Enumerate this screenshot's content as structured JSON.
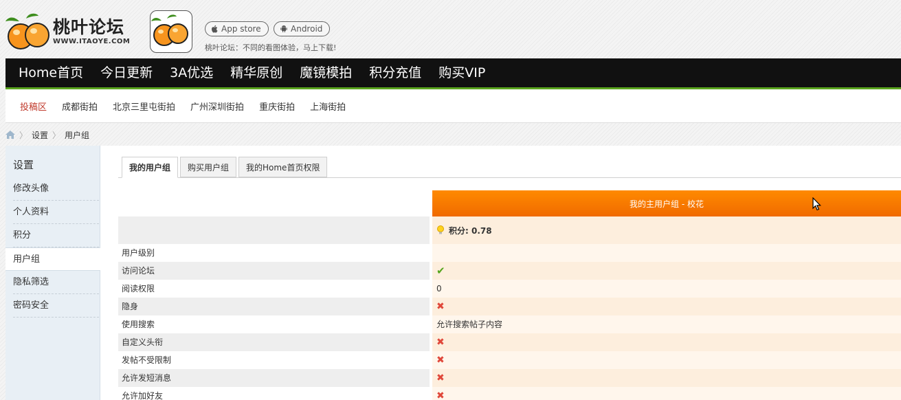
{
  "header": {
    "logo_text": "桃叶论坛",
    "logo_sub": "WWW.ITAOYE.COM",
    "appstore_label": "App store",
    "android_label": "Android",
    "app_tagline": "桃叶论坛：不同的看图体验，马上下载!"
  },
  "main_nav": [
    "Home首页",
    "今日更新",
    "3A优选",
    "精华原创",
    "魔镜模拍",
    "积分充值",
    "购买VIP"
  ],
  "sub_nav": [
    "投稿区",
    "成都街拍",
    "北京三里屯街拍",
    "广州深圳街拍",
    "重庆街拍",
    "上海街拍"
  ],
  "breadcrumb": [
    "设置",
    "用户组"
  ],
  "sidebar": {
    "title": "设置",
    "items": [
      "修改头像",
      "个人资料",
      "积分",
      "用户组",
      "隐私筛选",
      "密码安全"
    ]
  },
  "tabs": [
    "我的用户组",
    "购买用户组",
    "我的Home首页权限"
  ],
  "group": {
    "header": "我的主用户组 - 校花",
    "points": "积分: 0.78"
  },
  "rows": [
    {
      "label": "用户级别",
      "value": ""
    },
    {
      "label": "访问论坛",
      "value": "check"
    },
    {
      "label": "阅读权限",
      "value": "0"
    },
    {
      "label": "隐身",
      "value": "x"
    },
    {
      "label": "使用搜索",
      "value": "允许搜索帖子内容"
    },
    {
      "label": "自定义头衔",
      "value": "x"
    },
    {
      "label": "发帖不受限制",
      "value": "x"
    },
    {
      "label": "允许发短消息",
      "value": "x"
    },
    {
      "label": "允许加好友",
      "value": "x"
    }
  ],
  "colors": {
    "nav_bg": "#111111",
    "nav_accent": "#5aa51e",
    "group_header": "#f57c00",
    "active_subnav": "#c0392b"
  }
}
